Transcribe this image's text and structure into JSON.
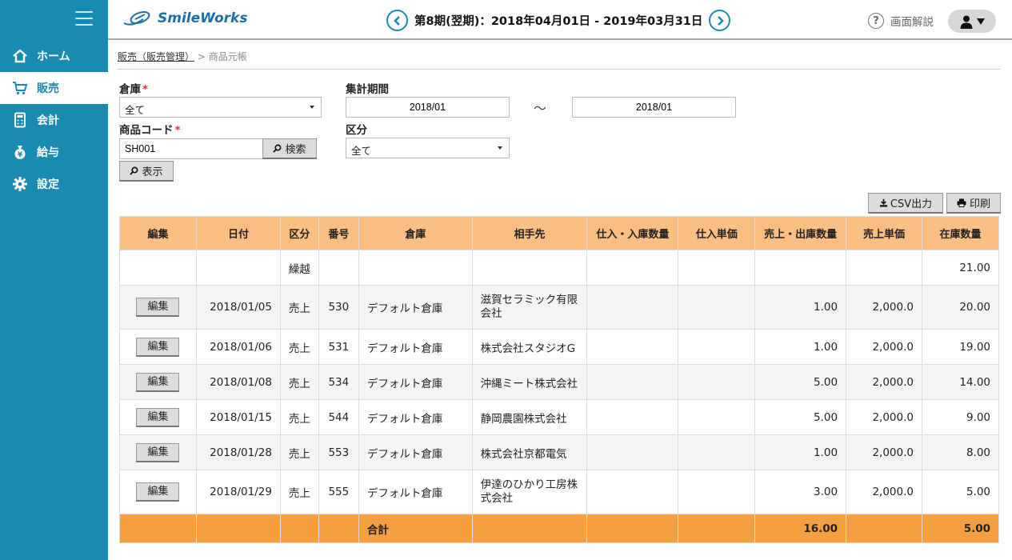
{
  "app": {
    "logo_text": "SmileWorks"
  },
  "sidebar": {
    "items": [
      {
        "label": "ホーム",
        "icon": "home-icon"
      },
      {
        "label": "販売",
        "icon": "cart-icon",
        "active": true
      },
      {
        "label": "会計",
        "icon": "calculator-icon"
      },
      {
        "label": "給与",
        "icon": "money-bag-icon"
      },
      {
        "label": "設定",
        "icon": "gear-icon"
      }
    ]
  },
  "header": {
    "period": "第8期(翌期)：2018年04月01日 - 2019年03月31日",
    "help_label": "画面解説",
    "help_symbol": "?"
  },
  "breadcrumb": {
    "parent": "販売（販売管理）",
    "separator": ">",
    "current": "商品元帳"
  },
  "form": {
    "warehouse_label": "倉庫",
    "warehouse_value": "全て",
    "product_code_label": "商品コード",
    "product_code_value": "SH001",
    "search_button": "検索",
    "display_button": "表示",
    "period_label": "集計期間",
    "period_from": "2018/01",
    "period_tilde": "〜",
    "period_to": "2018/01",
    "category_label": "区分",
    "category_value": "全て",
    "required_mark": "*"
  },
  "toolbar": {
    "csv_button": "CSV出力",
    "print_button": "印刷"
  },
  "table": {
    "headers": [
      "編集",
      "日付",
      "区分",
      "番号",
      "倉庫",
      "相手先",
      "仕入・入庫数量",
      "仕入単価",
      "売上・出庫数量",
      "売上単価",
      "在庫数量"
    ],
    "carry_over": {
      "category": "繰越",
      "stock": "21.00"
    },
    "edit_label": "編集",
    "rows": [
      {
        "date": "2018/01/05",
        "category": "売上",
        "number": "530",
        "warehouse": "デフォルト倉庫",
        "partner": "滋賀セラミック有限会社",
        "sales_qty": "1.00",
        "sales_price": "2,000.0",
        "stock": "20.00"
      },
      {
        "date": "2018/01/06",
        "category": "売上",
        "number": "531",
        "warehouse": "デフォルト倉庫",
        "partner": "株式会社スタジオG",
        "sales_qty": "1.00",
        "sales_price": "2,000.0",
        "stock": "19.00"
      },
      {
        "date": "2018/01/08",
        "category": "売上",
        "number": "534",
        "warehouse": "デフォルト倉庫",
        "partner": "沖縄ミート株式会社",
        "sales_qty": "5.00",
        "sales_price": "2,000.0",
        "stock": "14.00"
      },
      {
        "date": "2018/01/15",
        "category": "売上",
        "number": "544",
        "warehouse": "デフォルト倉庫",
        "partner": "静岡農園株式会社",
        "sales_qty": "5.00",
        "sales_price": "2,000.0",
        "stock": "9.00"
      },
      {
        "date": "2018/01/28",
        "category": "売上",
        "number": "553",
        "warehouse": "デフォルト倉庫",
        "partner": "株式会社京都電気",
        "sales_qty": "1.00",
        "sales_price": "2,000.0",
        "stock": "8.00"
      },
      {
        "date": "2018/01/29",
        "category": "売上",
        "number": "555",
        "warehouse": "デフォルト倉庫",
        "partner": "伊達のひかり工房株式会社",
        "sales_qty": "3.00",
        "sales_price": "2,000.0",
        "stock": "5.00"
      }
    ],
    "total": {
      "label": "合計",
      "sales_qty": "16.00",
      "stock": "5.00"
    }
  },
  "colors": {
    "sidebar": "#1b8ab0",
    "table_header": "#fdbe82",
    "total_row": "#f4a041"
  }
}
